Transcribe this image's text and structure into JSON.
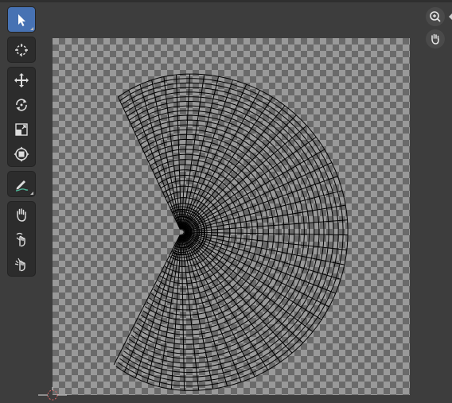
{
  "window": {
    "title": ""
  },
  "toolbar": {
    "groups": [
      [
        {
          "icon": "select-box-icon",
          "active": true,
          "corner": true
        }
      ],
      [
        {
          "icon": "cursor-icon",
          "active": false,
          "corner": false
        }
      ],
      [
        {
          "icon": "move-icon",
          "active": false,
          "corner": false
        },
        {
          "icon": "rotate-icon",
          "active": false,
          "corner": false
        },
        {
          "icon": "scale-icon",
          "active": false,
          "corner": false
        },
        {
          "icon": "transform-icon",
          "active": false,
          "corner": false
        }
      ],
      [
        {
          "icon": "annotate-icon",
          "active": false,
          "corner": true
        }
      ],
      [
        {
          "icon": "grab-icon",
          "active": false,
          "corner": false
        },
        {
          "icon": "relax-icon",
          "active": false,
          "corner": false
        },
        {
          "icon": "pinch-icon",
          "active": false,
          "corner": false
        }
      ]
    ]
  },
  "navigation": {
    "zoom": {
      "icon": "zoom-icon"
    },
    "pan": {
      "icon": "pan-hand-icon"
    }
  },
  "colors": {
    "active_tool": "#4772b3",
    "background": "#3d3d3d",
    "mesh_lines": "#000000"
  }
}
